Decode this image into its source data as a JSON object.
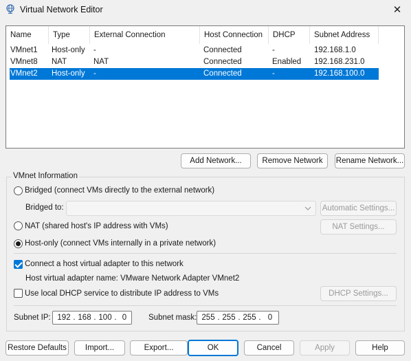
{
  "window": {
    "title": "Virtual Network Editor"
  },
  "networks": {
    "columns": [
      "Name",
      "Type",
      "External Connection",
      "Host Connection",
      "DHCP",
      "Subnet Address"
    ],
    "rows": [
      [
        "VMnet1",
        "Host-only",
        "-",
        "Connected",
        "-",
        "192.168.1.0"
      ],
      [
        "VMnet8",
        "NAT",
        "NAT",
        "Connected",
        "Enabled",
        "192.168.231.0"
      ],
      [
        "VMnet2",
        "Host-only",
        "-",
        "Connected",
        "-",
        "192.168.100.0"
      ]
    ],
    "selected_row": 2
  },
  "list_buttons": {
    "add": "Add Network...",
    "remove": "Remove Network",
    "rename": "Rename Network..."
  },
  "vmnet_info": {
    "group_label": "VMnet Information",
    "bridged_label": "Bridged (connect VMs directly to the external network)",
    "bridged_to_label": "Bridged to:",
    "bridged_to_value": "",
    "automatic_settings": "Automatic Settings...",
    "nat_label": "NAT (shared host's IP address with VMs)",
    "nat_settings": "NAT Settings...",
    "hostonly_label": "Host-only (connect VMs internally in a private network)",
    "selected_mode": "host-only",
    "connect_adapter_label": "Connect a host virtual adapter to this network",
    "connect_adapter_checked": true,
    "adapter_name_label": "Host virtual adapter name: VMware Network Adapter VMnet2",
    "dhcp_label": "Use local DHCP service to distribute IP address to VMs",
    "dhcp_checked": false,
    "dhcp_settings": "DHCP Settings...",
    "subnet_ip_label": "Subnet IP:",
    "subnet_ip": [
      "192",
      "168",
      "100",
      "0"
    ],
    "subnet_mask_label": "Subnet mask:",
    "subnet_mask": [
      "255",
      "255",
      "255",
      "0"
    ]
  },
  "footer": {
    "restore_defaults": "Restore Defaults",
    "import": "Import...",
    "export": "Export...",
    "ok": "OK",
    "cancel": "Cancel",
    "apply": "Apply",
    "help": "Help"
  },
  "colors": {
    "selection": "#0078d7",
    "accent": "#0078d7"
  },
  "icons": {
    "app": "network-globe-icon",
    "close": "close-icon",
    "dropdown": "chevron-down-icon"
  }
}
